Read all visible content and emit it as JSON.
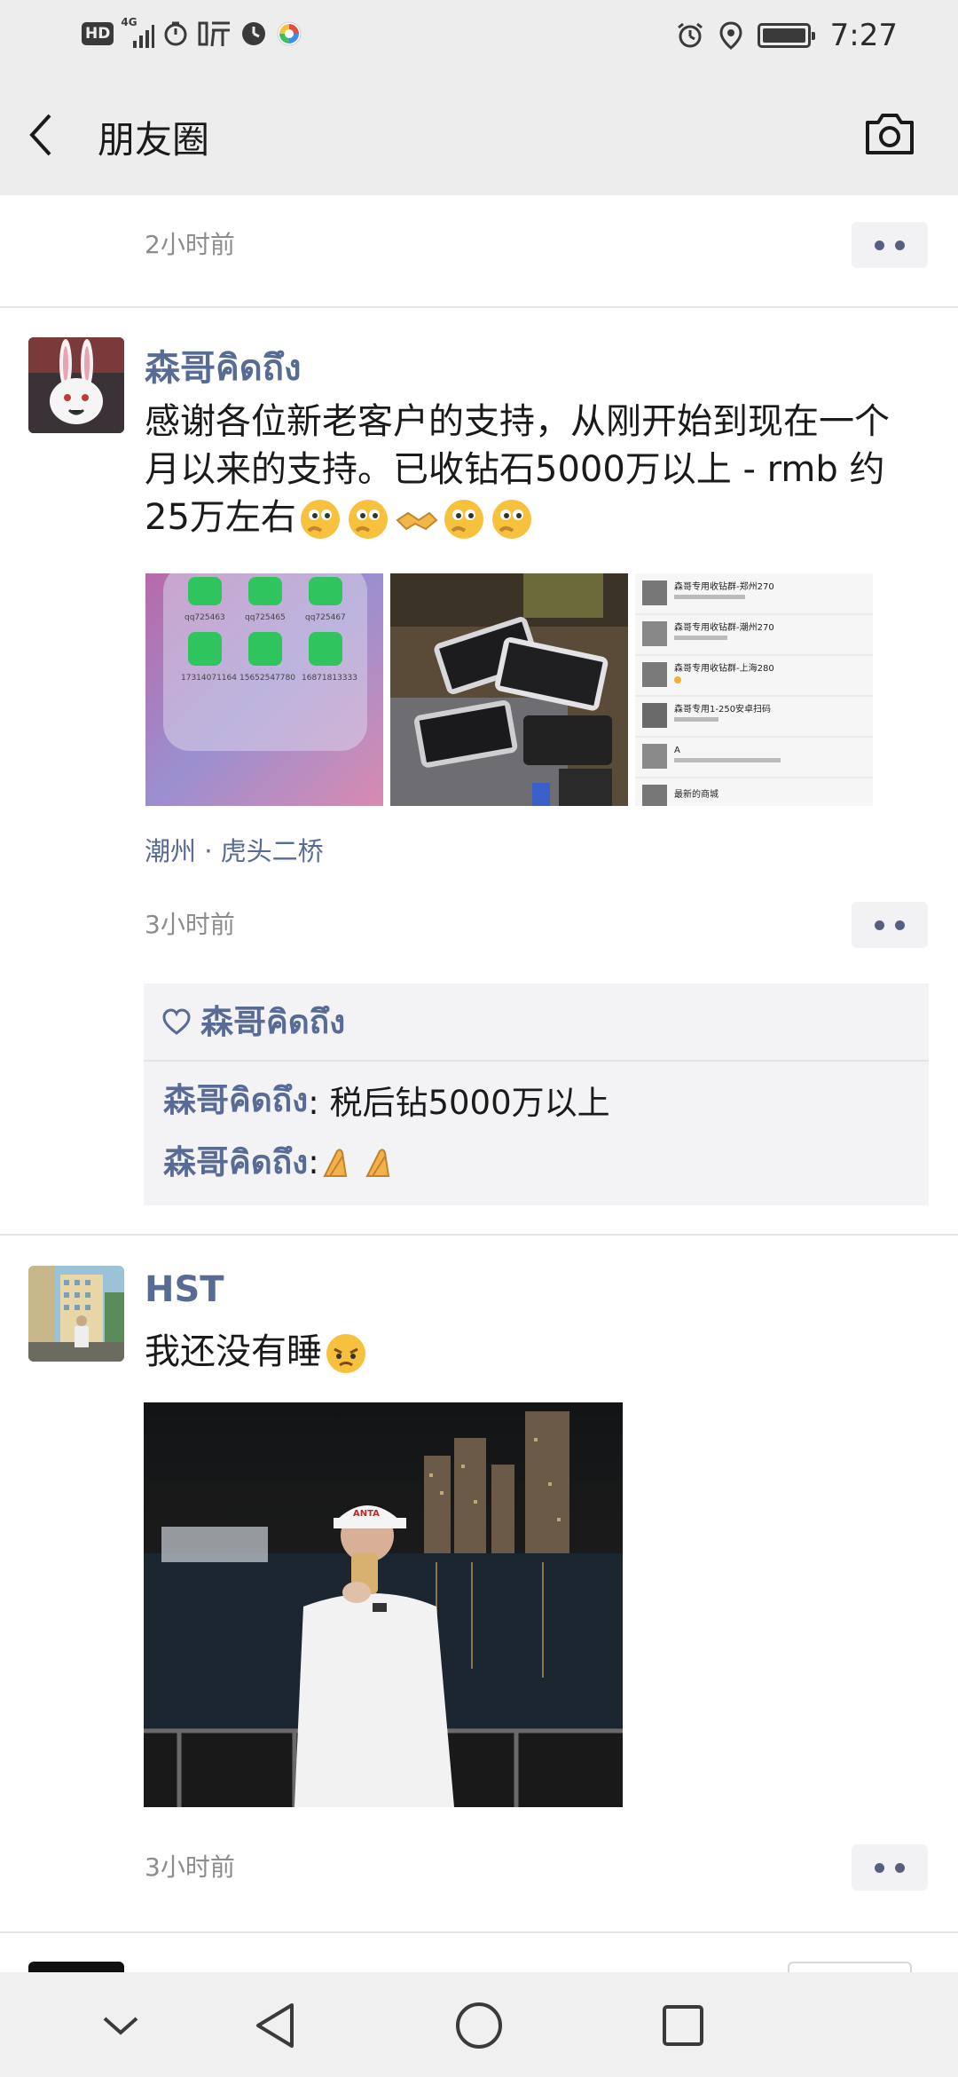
{
  "status_bar": {
    "hd": "HD",
    "network": "4G",
    "time": "7:27"
  },
  "header": {
    "title": "朋友圈",
    "back_icon": "chevron-left-icon",
    "camera_icon": "camera-icon"
  },
  "posts": [
    {
      "time": "2小时前"
    },
    {
      "author": "森哥คิดถึง",
      "text": "感谢各位新老客户的支持，从刚开始到现在一个月以来的支持。已收钻石5000万以上 - rmb 约 25万左右",
      "location": "潮州 · 虎头二桥",
      "time": "3小时前",
      "thumbnails": [
        {
          "labels": [
            "qq725463",
            "qq725465",
            "qq725467",
            "17314071164",
            "15652547780",
            "16871813333"
          ]
        },
        {
          "labels": []
        },
        {
          "labels": [
            "森哥专用收钻群-郑州270",
            "森哥专用收钻群-潮州270",
            "森哥专用收钻群-上海280",
            "森哥专用1-250安卓扫码",
            "A",
            "最新的商城"
          ]
        }
      ],
      "likes": [
        "森哥คิดถึง"
      ],
      "comments": [
        {
          "name": "森哥คิดถึง",
          "text": ": 税后钻5000万以上"
        },
        {
          "name": "森哥คิดถึง",
          "text": ": "
        }
      ]
    },
    {
      "author": "HST",
      "text": "我还没有睡",
      "time": "3小时前",
      "photo_caption": "ANTA"
    }
  ],
  "nav_bar": {
    "icons": [
      "collapse-icon",
      "back-triangle-icon",
      "home-circle-icon",
      "recents-square-icon"
    ]
  },
  "colors": {
    "link_blue": "#576b95",
    "header_bg": "#ededed",
    "comment_bg": "#f3f3f5"
  }
}
